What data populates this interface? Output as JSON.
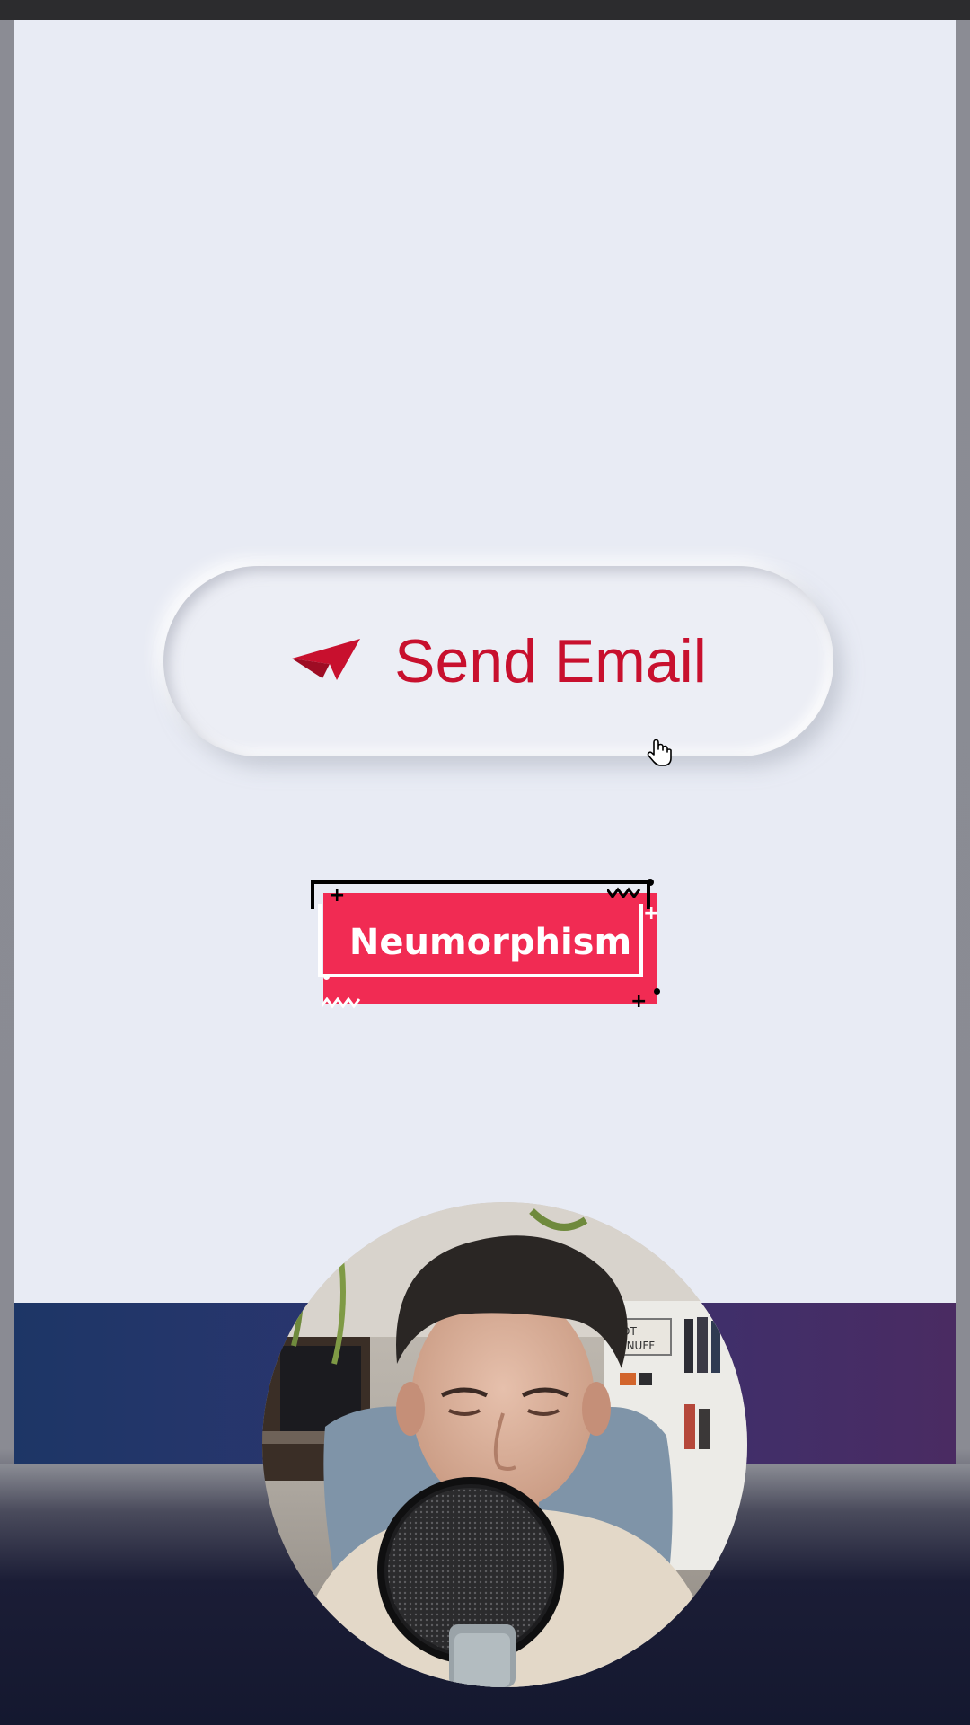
{
  "stage": {
    "background": "#e8ebf4"
  },
  "send_button": {
    "label": "Send Email",
    "icon": "paper-plane-icon",
    "color": "#c8102e"
  },
  "caption": {
    "text": "Neumorphism",
    "fill_color": "#f12b53"
  },
  "webcam": {
    "description_icon": "presenter-webcam"
  },
  "cursor": {
    "icon": "hand-pointer-icon"
  }
}
